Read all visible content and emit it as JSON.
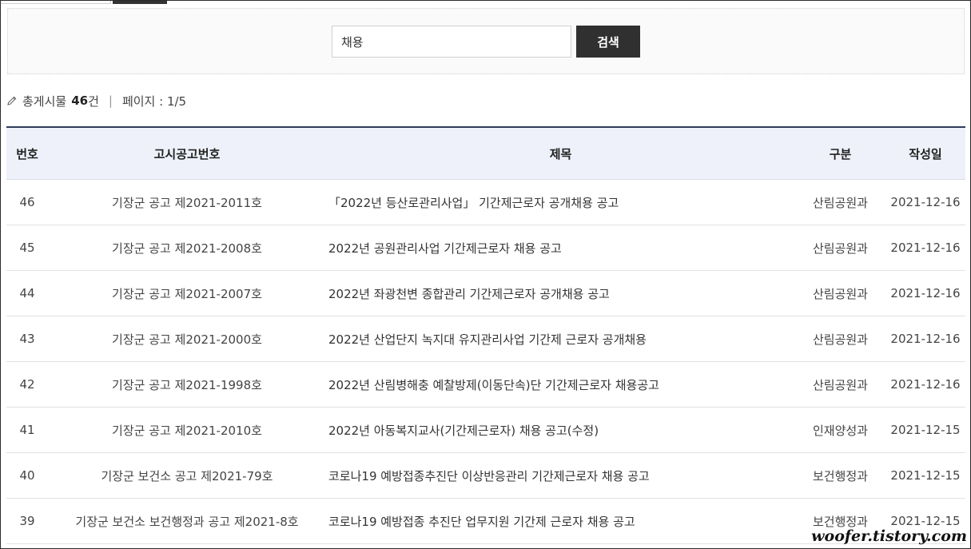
{
  "search": {
    "value": "채용",
    "button_label": "검색"
  },
  "summary": {
    "total_label": "총게시물",
    "total_count": "46",
    "count_unit": "건",
    "separator": "|",
    "page_label": "페이지 : 1/5"
  },
  "table": {
    "headers": {
      "num": "번호",
      "notice": "고시공고번호",
      "title": "제목",
      "dept": "구분",
      "date": "작성일"
    },
    "rows": [
      {
        "num": "46",
        "notice": "기장군 공고 제2021-2011호",
        "title": "「2022년 등산로관리사업」 기간제근로자 공개채용 공고",
        "dept": "산림공원과",
        "date": "2021-12-16"
      },
      {
        "num": "45",
        "notice": "기장군 공고 제2021-2008호",
        "title": "2022년 공원관리사업 기간제근로자 채용 공고",
        "dept": "산림공원과",
        "date": "2021-12-16"
      },
      {
        "num": "44",
        "notice": "기장군 공고 제2021-2007호",
        "title": "2022년 좌광천변 종합관리 기간제근로자 공개채용 공고",
        "dept": "산림공원과",
        "date": "2021-12-16"
      },
      {
        "num": "43",
        "notice": "기장군 공고 제2021-2000호",
        "title": "2022년 산업단지 녹지대 유지관리사업 기간제 근로자 공개채용",
        "dept": "산림공원과",
        "date": "2021-12-16"
      },
      {
        "num": "42",
        "notice": "기장군 공고 제2021-1998호",
        "title": "2022년 산림병해충 예찰방제(이동단속)단 기간제근로자 채용공고",
        "dept": "산림공원과",
        "date": "2021-12-16"
      },
      {
        "num": "41",
        "notice": "기장군 공고 제2021-2010호",
        "title": "2022년 아동복지교사(기간제근로자) 채용 공고(수정)",
        "dept": "인재양성과",
        "date": "2021-12-15"
      },
      {
        "num": "40",
        "notice": "기장군 보건소 공고 제2021-79호",
        "title": "코로나19 예방접종추진단 이상반응관리 기간제근로자 채용 공고",
        "dept": "보건행정과",
        "date": "2021-12-15"
      },
      {
        "num": "39",
        "notice": "기장군 보건소 보건행정과 공고 제2021-8호",
        "title": "코로나19 예방접종 추진단 업무지원 기간제 근로자 채용 공고",
        "dept": "보건행정과",
        "date": "2021-12-15"
      }
    ]
  },
  "watermark": "woofer.tistory.com",
  "colors": {
    "header_bg": "#eef1f9",
    "header_border": "#2f3b5a",
    "button_bg": "#303030"
  },
  "icons": {
    "summary": "pencil-icon"
  }
}
